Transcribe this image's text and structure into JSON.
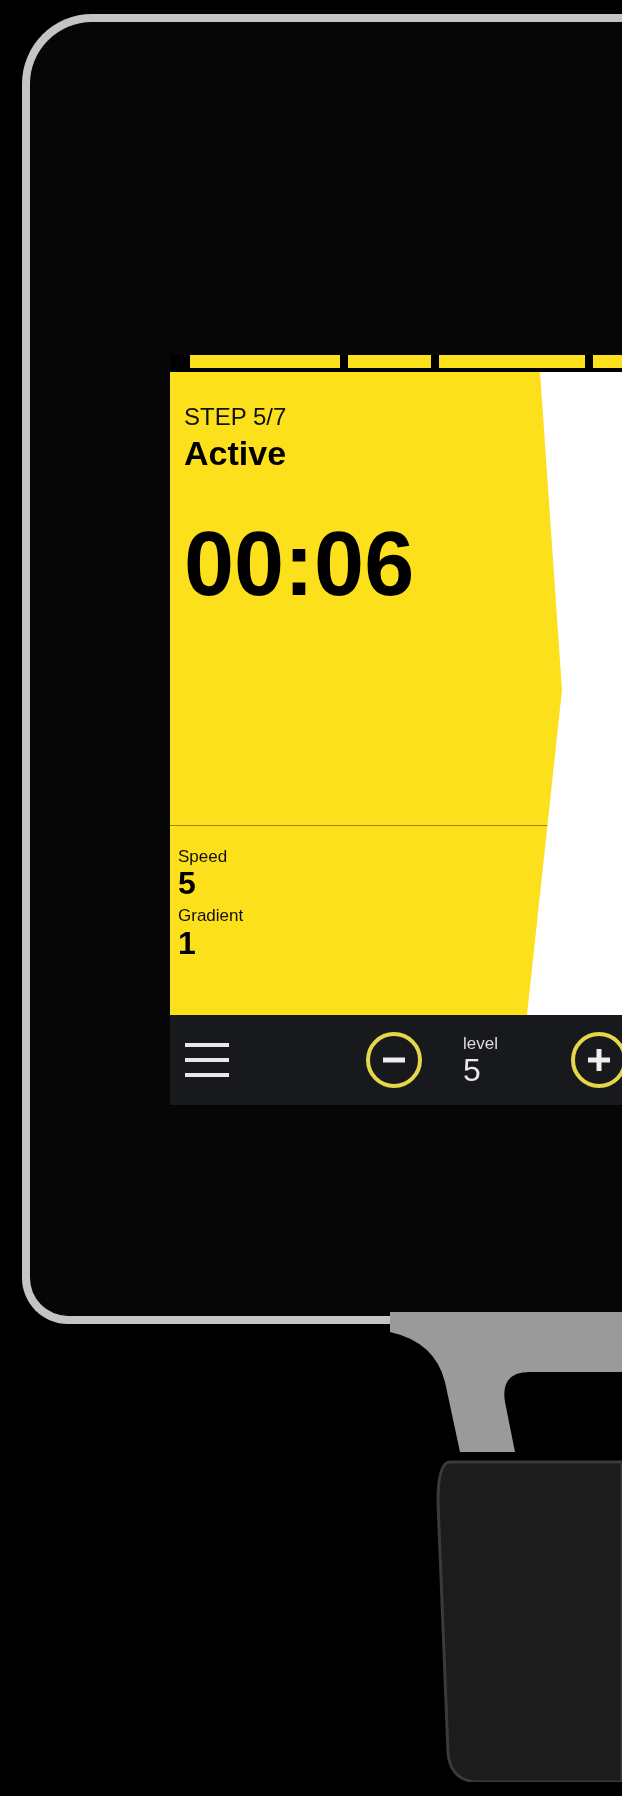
{
  "progress_segments": [
    {
      "done": true
    },
    {
      "done": true
    },
    {
      "done": true
    },
    {
      "done": true
    }
  ],
  "step": "STEP 5/7",
  "phase": "Active",
  "timer": "00:06",
  "metrics": [
    {
      "label": "Speed",
      "value": "5"
    },
    {
      "label": "Gradient",
      "value": "1"
    }
  ],
  "bottom_bar": {
    "level_label": "level",
    "level_value": "5"
  }
}
